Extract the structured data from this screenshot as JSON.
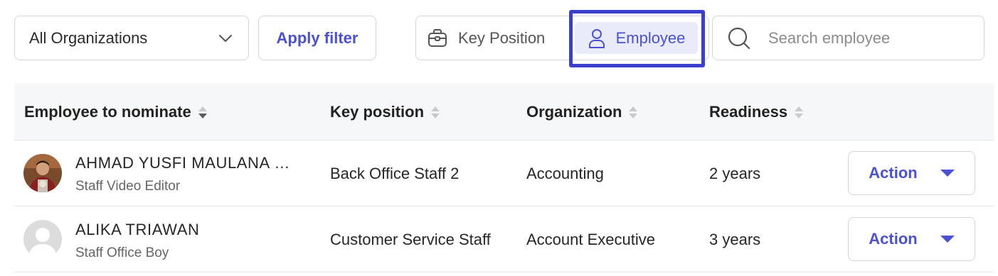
{
  "filter": {
    "organization_value": "All Organizations",
    "apply_label": "Apply filter"
  },
  "view_toggle": {
    "key_position_label": "Key Position",
    "employee_label": "Employee",
    "selected": "Employee"
  },
  "search": {
    "placeholder": "Search employee"
  },
  "table": {
    "columns": [
      "Employee to nominate",
      "Key position",
      "Organization",
      "Readiness"
    ],
    "rows": [
      {
        "name": "AHMAD YUSFI MAULANA …",
        "title": "Staff Video Editor",
        "key_position": "Back Office Staff 2",
        "organization": "Accounting",
        "readiness": "2 years",
        "action_label": "Action",
        "avatar": "photo-avatar"
      },
      {
        "name": "ALIKA TRIAWAN",
        "title": "Staff Office Boy",
        "key_position": "Customer Service Staff",
        "organization": "Account Executive",
        "readiness": "3 years",
        "action_label": "Action",
        "avatar": "default-avatar"
      }
    ]
  },
  "icons": {
    "organization_dropdown": "chevron-down-icon",
    "key_position": "briefcase-icon",
    "employee": "user-icon",
    "search": "search-icon",
    "action_dropdown": "caret-down-icon",
    "sort": "sort-icon"
  },
  "colors": {
    "accent": "#4a51d6",
    "highlight_outline": "#3b3fce",
    "selected_bg": "#e9ebfb",
    "header_bg": "#f6f7f9",
    "border": "#d3d5db"
  }
}
